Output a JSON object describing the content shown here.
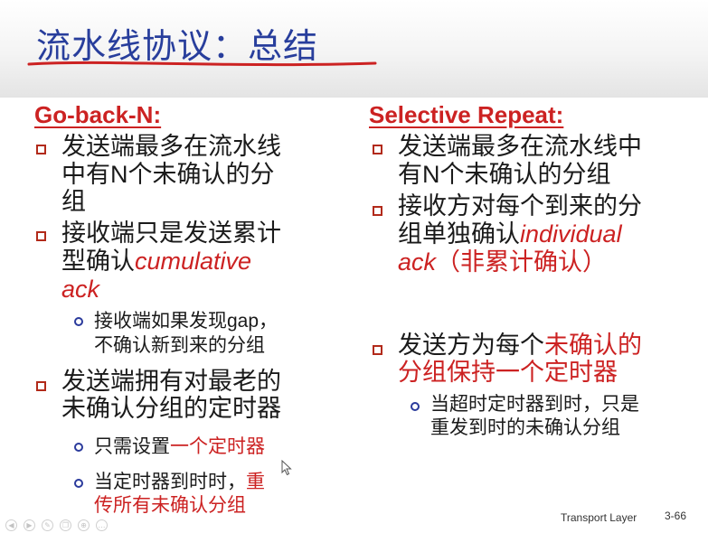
{
  "slide": {
    "title": "流水线协议：总结",
    "footer": "Transport Layer",
    "page_number": "3-66",
    "accent_colors": {
      "title": "#283e9c",
      "heading": "#cc2222",
      "underline": "#cc2222"
    }
  },
  "gbn": {
    "heading": "Go-back-N:",
    "b1": {
      "l1": "发送端最多在流水线",
      "l2": "中有",
      "l2_n": "N",
      "l2_b": "个未确认的分",
      "l3": "组"
    },
    "b2": {
      "l1": "接收端只是发送累计",
      "l2": "型确认",
      "l2_it": "cumulative",
      "l3_it": "ack"
    },
    "s1": {
      "l1": "接收端如果发现",
      "l1_gap": "gap",
      "l1_end": "，",
      "l2": "不确认新到来的分组"
    },
    "b3": {
      "l1": "发送端拥有对最老的",
      "l2": "未确认分组的定时器"
    },
    "s2": {
      "a": "只需设置",
      "red": "一个定时器"
    },
    "s3": {
      "a": "当定时器到时时，",
      "red1": "重",
      "red2": "传所有未确认分组"
    }
  },
  "sr": {
    "heading": "Selective Repeat:",
    "b1": {
      "l1": "发送端最多在流水线中",
      "l2": "有",
      "l2_n": "N",
      "l2_b": "个未确认的分组"
    },
    "b2": {
      "l1": "接收方对每个到来的分",
      "l2": "组单独确认",
      "l2_it": "individual",
      "l3_it": "ack",
      "l3_red": "（非累计确认）"
    },
    "b3": {
      "a": "发送方为每个",
      "red1": "未确认的",
      "red2": "分组保持一个定时器"
    },
    "s1": {
      "l1": "当超时定时器到时，只是",
      "l2": "重发到时的未确认分组"
    }
  },
  "player": {
    "icons": [
      "rewind-icon",
      "play-icon",
      "pen-icon",
      "copy-icon",
      "zoom-icon",
      "more-icon"
    ]
  }
}
